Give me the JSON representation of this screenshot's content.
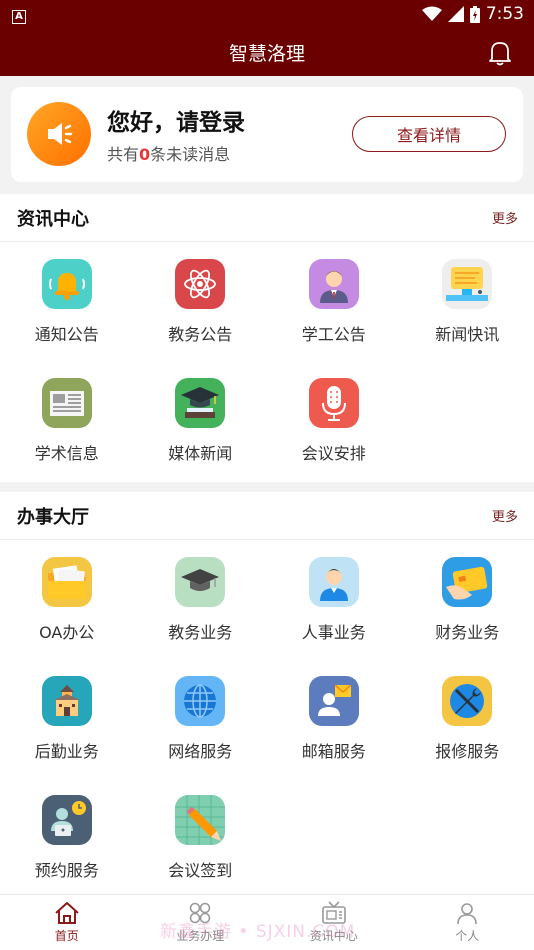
{
  "status_bar": {
    "badge": "A",
    "time": "7:53"
  },
  "app_bar": {
    "title": "智慧洛理"
  },
  "login_card": {
    "greeting": "您好，请登录",
    "unread_prefix": "共有",
    "unread_count": "0",
    "unread_suffix": "条未读消息",
    "detail_button": "查看详情"
  },
  "news_center": {
    "title": "资讯中心",
    "more": "更多",
    "items": [
      {
        "label": "通知公告",
        "icon": "bell-icon"
      },
      {
        "label": "教务公告",
        "icon": "atom-icon"
      },
      {
        "label": "学工公告",
        "icon": "teacher-icon"
      },
      {
        "label": "新闻快讯",
        "icon": "news-flash-icon"
      },
      {
        "label": "学术信息",
        "icon": "newspaper-icon"
      },
      {
        "label": "媒体新闻",
        "icon": "graduation-cap-icon"
      },
      {
        "label": "会议安排",
        "icon": "microphone-icon"
      }
    ]
  },
  "service_hall": {
    "title": "办事大厅",
    "more": "更多",
    "items": [
      {
        "label": "OA办公",
        "icon": "folder-icon"
      },
      {
        "label": "教务业务",
        "icon": "graduation-cap-icon"
      },
      {
        "label": "人事业务",
        "icon": "person-icon"
      },
      {
        "label": "财务业务",
        "icon": "credit-card-icon"
      },
      {
        "label": "后勤业务",
        "icon": "building-icon"
      },
      {
        "label": "网络服务",
        "icon": "globe-icon"
      },
      {
        "label": "邮箱服务",
        "icon": "mail-icon"
      },
      {
        "label": "报修服务",
        "icon": "wrench-icon"
      },
      {
        "label": "预约服务",
        "icon": "appointment-icon"
      },
      {
        "label": "会议签到",
        "icon": "pencil-icon"
      }
    ]
  },
  "tabbar": {
    "items": [
      {
        "label": "首页",
        "icon": "home-icon"
      },
      {
        "label": "业务办理",
        "icon": "grid-icon"
      },
      {
        "label": "资讯中心",
        "icon": "tv-icon"
      },
      {
        "label": "个人",
        "icon": "user-icon"
      }
    ]
  },
  "watermark": "新鑫手游 • SJXIN.COM",
  "colors": {
    "primary": "#6b0000",
    "accent": "#8b1a1a",
    "unread": "#e53935"
  }
}
